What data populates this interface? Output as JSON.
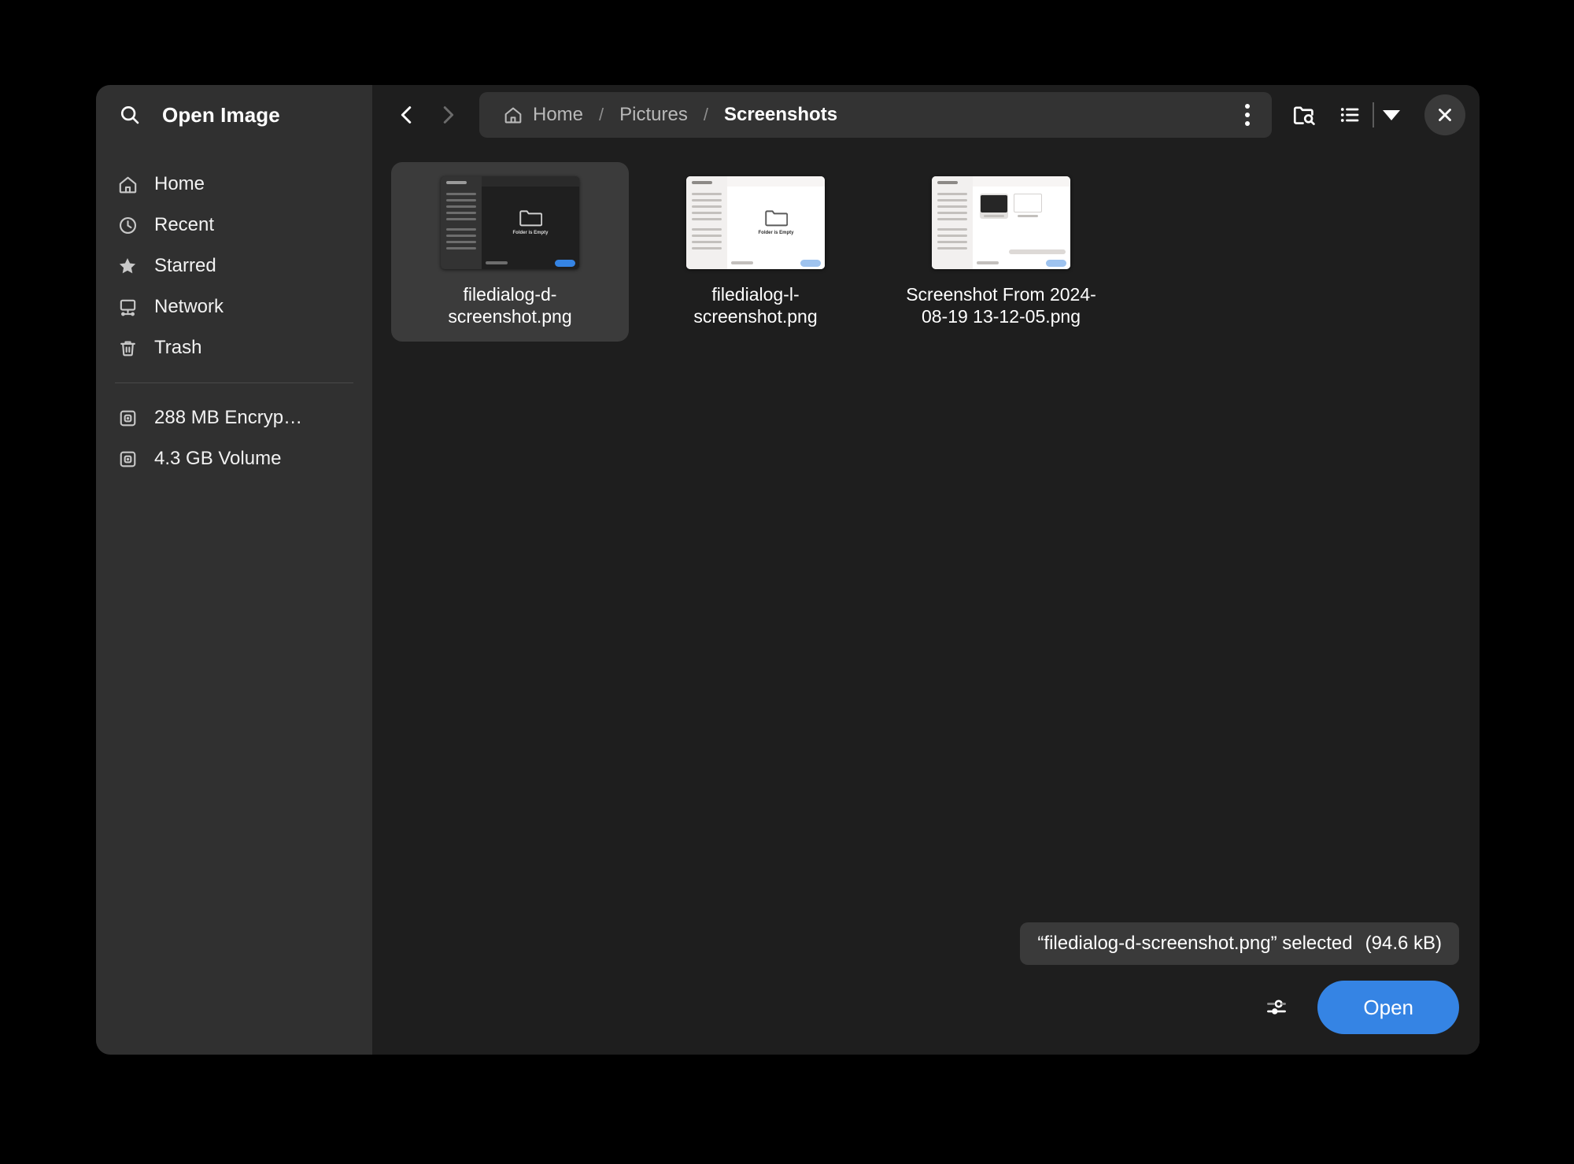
{
  "dialog": {
    "title": "Open Image",
    "search_icon": "search-icon",
    "close_icon": "close-icon"
  },
  "sidebar": {
    "places": [
      {
        "label": "Home",
        "icon": "home-icon"
      },
      {
        "label": "Recent",
        "icon": "clock-icon"
      },
      {
        "label": "Starred",
        "icon": "star-icon"
      },
      {
        "label": "Network",
        "icon": "network-icon"
      },
      {
        "label": "Trash",
        "icon": "trash-icon"
      }
    ],
    "volumes": [
      {
        "label": "288 MB Encryp…",
        "icon": "drive-icon"
      },
      {
        "label": "4.3 GB Volume",
        "icon": "drive-icon"
      }
    ]
  },
  "header": {
    "back_icon": "chevron-left-icon",
    "forward_icon": "chevron-right-icon",
    "breadcrumbs": [
      {
        "label": "Home",
        "icon": "home-icon",
        "current": false
      },
      {
        "label": "Pictures",
        "icon": "",
        "current": false
      },
      {
        "label": "Screenshots",
        "icon": "",
        "current": true
      }
    ],
    "separator": "/",
    "menu_icon": "vertical-ellipsis-icon",
    "search_folder_icon": "folder-search-icon",
    "view_list_icon": "list-view-icon",
    "view_dropdown_icon": "chevron-down-icon"
  },
  "files": [
    {
      "name": "filedialog-d-screenshot.png",
      "selected": true,
      "thumb_kind": "dark-dialog",
      "thumb_text": "Folder is Empty"
    },
    {
      "name": "filedialog-l-screenshot.png",
      "selected": false,
      "thumb_kind": "light-dialog",
      "thumb_text": "Folder is Empty"
    },
    {
      "name": "Screenshot From 2024-08-19 13-12-05.png",
      "selected": false,
      "thumb_kind": "light-grid",
      "thumb_text": ""
    }
  ],
  "status": {
    "selection_text": "“filedialog-d-screenshot.png” selected",
    "size_text": "(94.6 kB)"
  },
  "actions": {
    "filter_icon": "filter-settings-icon",
    "open_label": "Open"
  },
  "colors": {
    "accent": "#3584e4",
    "dialog_bg": "#1e1e1e",
    "sidebar_bg": "#303030",
    "selected_cell": "#3b3b3b",
    "pathbar_bg": "#333333",
    "toast_bg": "#3a3a3a"
  }
}
